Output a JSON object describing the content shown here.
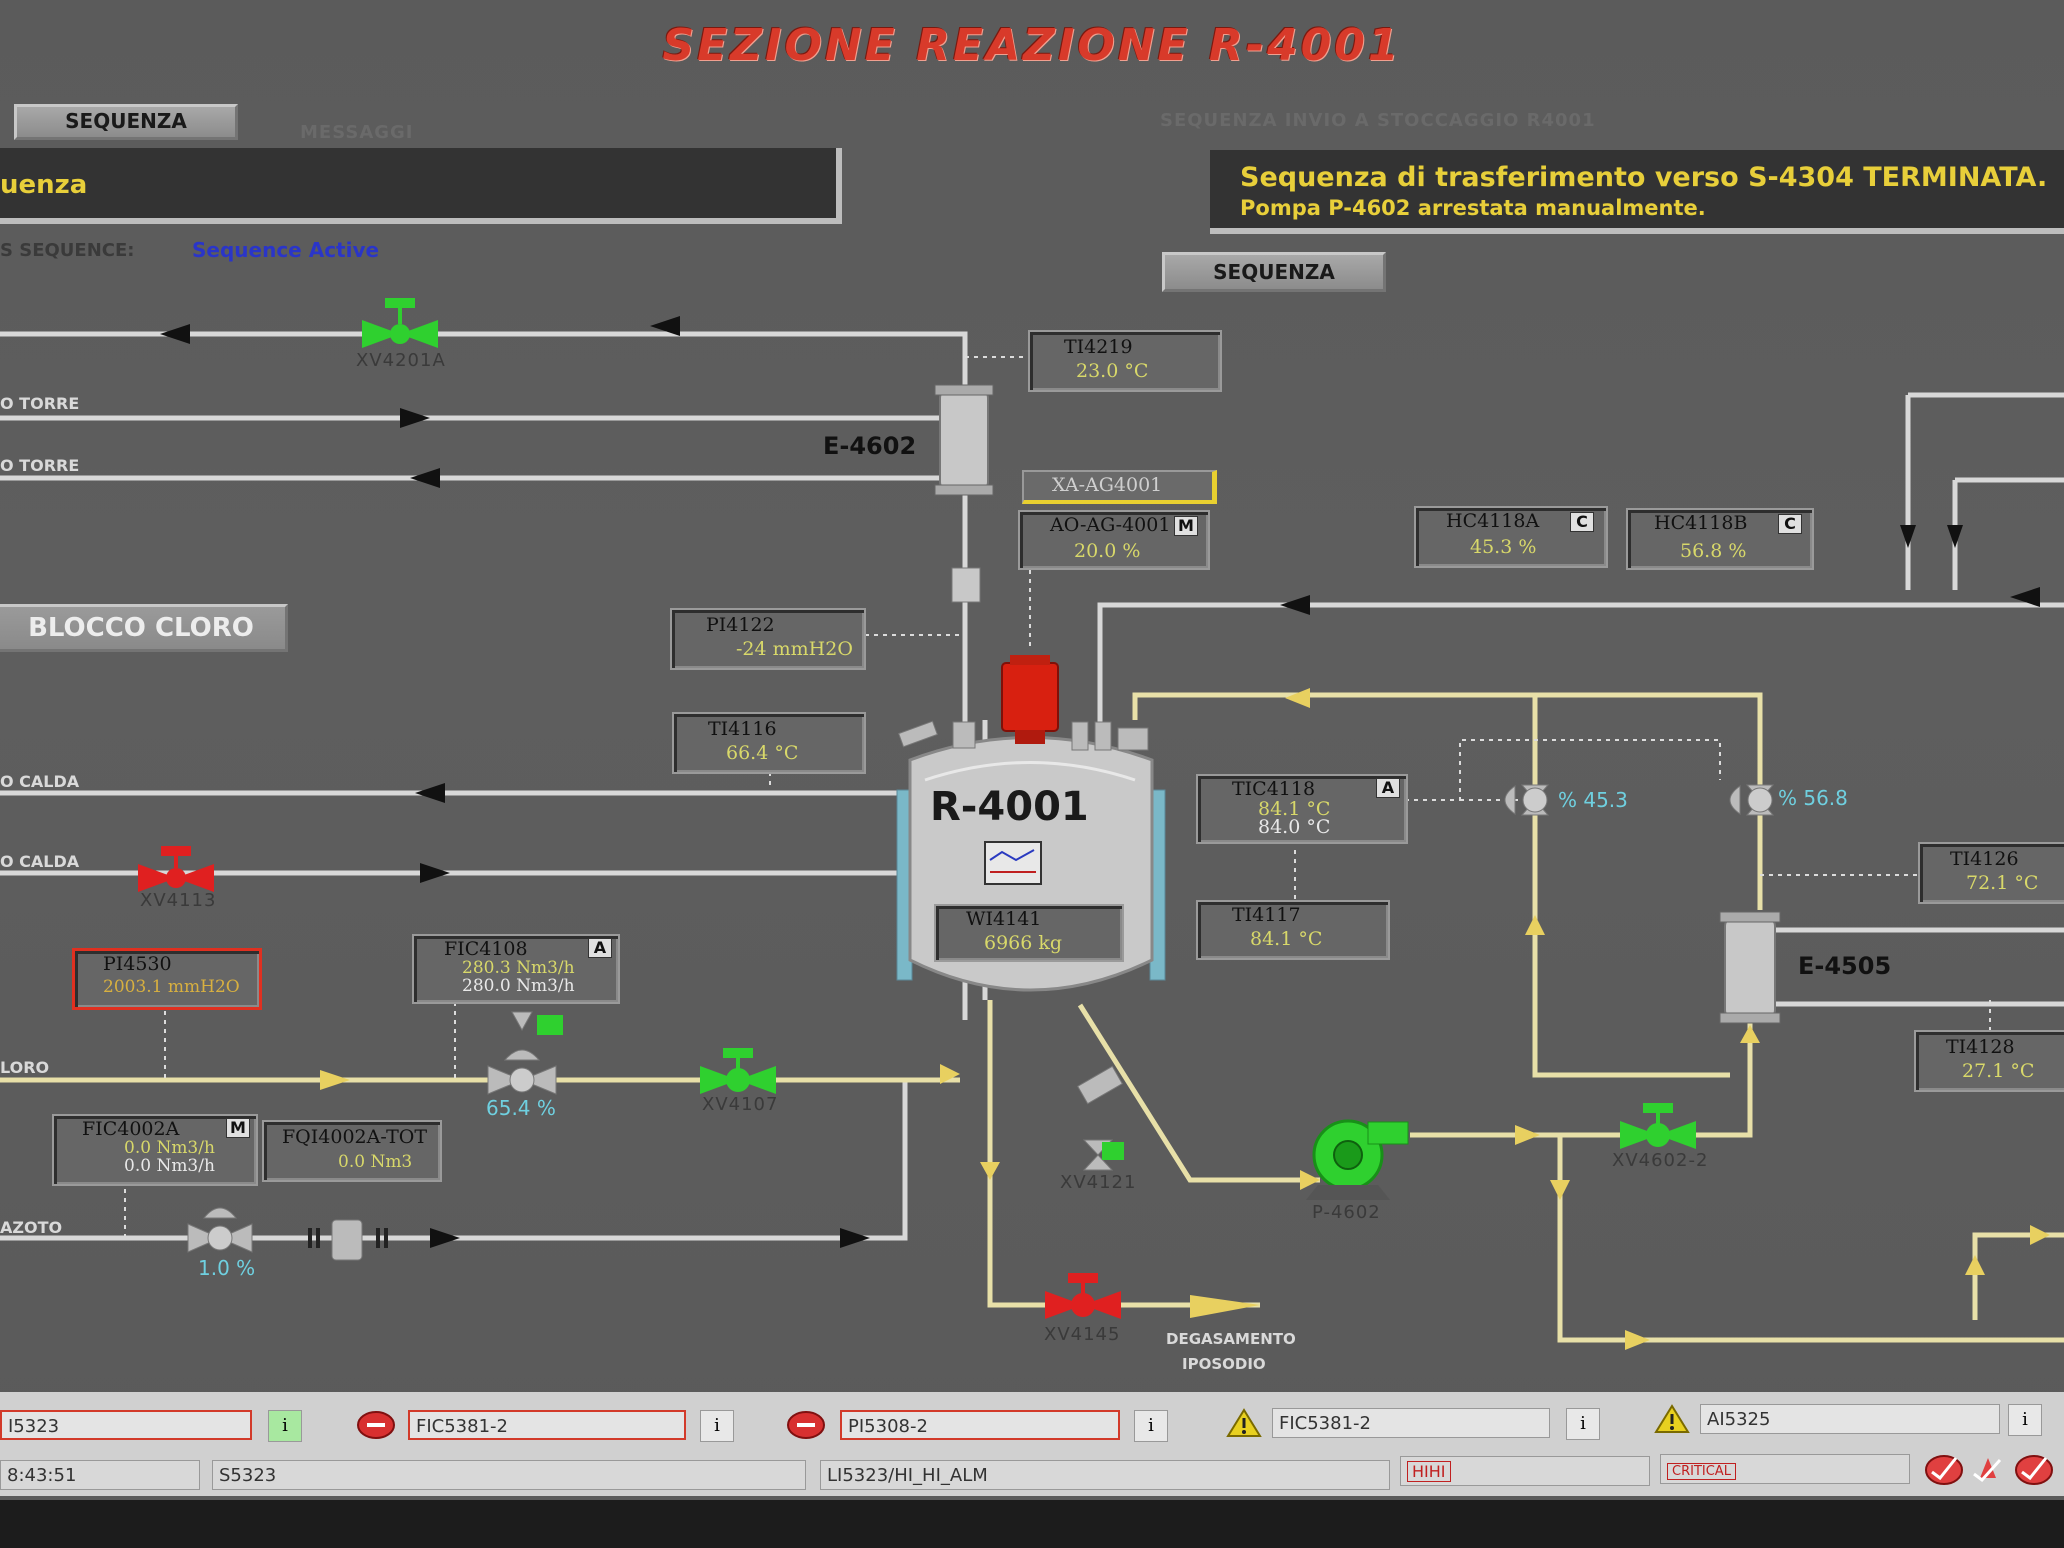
{
  "title": "SEZIONE REAZIONE R-4001",
  "left_panel": {
    "seq_button": "SEQUENZA",
    "faint_header": "MESSAGGI",
    "message": "uenza",
    "status_label": "S SEQUENCE:",
    "status_value": "Sequence Active",
    "block_button": "BLOCCO CLORO"
  },
  "right_panel": {
    "faint_header": "SEQUENZA INVIO A STOCCAGGIO R4001",
    "message_line1": "Sequenza di trasferimento verso S-4304 TERMINATA.",
    "message_line2": "Pompa P-4602 arrestata manualmente.",
    "seq_button": "SEQUENZA"
  },
  "line_labels": {
    "torre1": "O TORRE",
    "torre2": "O TORRE",
    "calda1": "O CALDA",
    "calda2": "O CALDA",
    "cloro": "LORO",
    "azoto": "AZOTO",
    "degas1": "DEGASAMENTO",
    "degas2": "IPOSODIO"
  },
  "equipment": {
    "reactor": "R-4001",
    "exch1": "E-4602",
    "exch2": "E-4505",
    "pump": "P-4602"
  },
  "instruments": {
    "ti4219": {
      "tag": "TI4219",
      "value": "23.0 °C"
    },
    "xa_ag": {
      "tag": "XA-AG4001"
    },
    "ao_ag": {
      "tag": "AO-AG-4001",
      "mode": "M",
      "value": "20.0 %"
    },
    "pi4122": {
      "tag": "PI4122",
      "value": "-24 mmH2O"
    },
    "ti4116": {
      "tag": "TI4116",
      "value": "66.4 °C"
    },
    "wi4141": {
      "tag": "WI4141",
      "value": "6966 kg"
    },
    "tic4118": {
      "tag": "TIC4118",
      "mode": "A",
      "value1": "84.1 °C",
      "value2": "84.0 °C"
    },
    "ti4117": {
      "tag": "TI4117",
      "value": "84.1 °C"
    },
    "hc4118a": {
      "tag": "HC4118A",
      "mode": "C",
      "value": "45.3 %"
    },
    "hc4118b": {
      "tag": "HC4118B",
      "mode": "C",
      "value": "56.8 %"
    },
    "ti4126": {
      "tag": "TI4126",
      "value": "72.1 °C"
    },
    "ti4128": {
      "tag": "TI4128",
      "value": "27.1 °C"
    },
    "pi4530": {
      "tag": "PI4530",
      "value": "2003.1 mmH2O"
    },
    "fic4108": {
      "tag": "FIC4108",
      "mode": "A",
      "value1": "280.3 Nm3/h",
      "value2": "280.0 Nm3/h"
    },
    "fic4002a": {
      "tag": "FIC4002A",
      "mode": "M",
      "value1": "0.0 Nm3/h",
      "value2": "0.0 Nm3/h"
    },
    "fqi4002a": {
      "tag": "FQI4002A-TOT",
      "value": "0.0 Nm3"
    }
  },
  "valves": {
    "xv4201a": "XV4201A",
    "xv4113": "XV4113",
    "xv4107": "XV4107",
    "xv4121": "XV4121",
    "xv4145": "XV4145",
    "xv4602": "XV4602-2",
    "cv_cloro_pct": "65.4 %",
    "cv_azoto_pct": "1.0 %",
    "cv_a_pct": "% 45.3",
    "cv_b_pct": "% 56.8"
  },
  "alarms": {
    "row1": [
      {
        "text": "I5323",
        "info": "i"
      },
      {
        "text": "FIC5381-2",
        "info": "i"
      },
      {
        "text": "PI5308-2",
        "info": "i"
      },
      {
        "text": "FIC5381-2",
        "info": "i"
      },
      {
        "text": "AI5325",
        "info": "i"
      }
    ],
    "row2": {
      "time": "8:43:51",
      "tag": "S5323",
      "desc": "LI5323/HI_HI_ALM",
      "priority": "HIHI",
      "severity": "CRITICAL"
    }
  },
  "colors": {
    "title_red": "#d83a2a",
    "valve_green": "#2fd02f",
    "valve_red": "#e02020",
    "pipe_yellow": "#e8e0a8",
    "value_yellow": "#d8d86a",
    "cyan": "#6fd0e0"
  }
}
